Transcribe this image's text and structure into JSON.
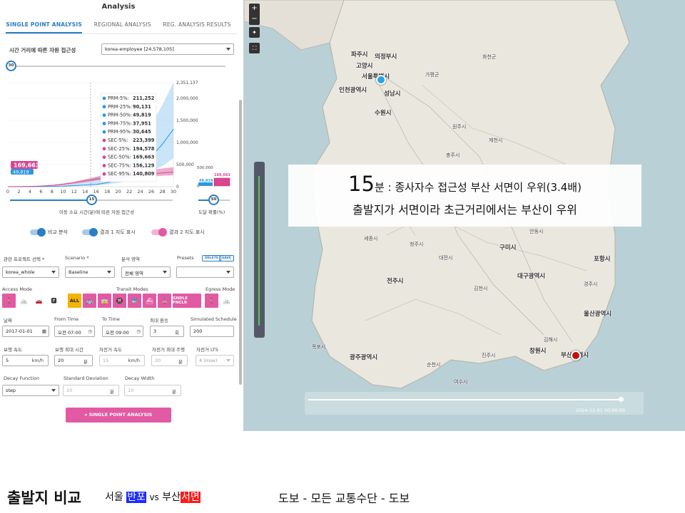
{
  "panel": {
    "title": "Analysis",
    "tabs": [
      "SINGLE POINT ANALYSIS",
      "REGIONAL ANALYSIS",
      "REG. ANALYSIS RESULTS"
    ],
    "chart_label": "시간 거리에 따른 자원 접근성",
    "dataset": "korea-employee [24,578,105]",
    "time_slider_value": "30",
    "time_slider_fraction": 0.0
  },
  "chart_data": {
    "type": "area",
    "xlabel": "이동 소요 시간(분)에 따른 자원 접근성",
    "x_ticks": [
      "0",
      "2",
      "4",
      "6",
      "8",
      "10",
      "12",
      "14",
      "16",
      "18",
      "20",
      "22",
      "24",
      "26",
      "28",
      "30"
    ],
    "y_ticks": [
      "2,351,137",
      "2,000,000",
      "1,500,000",
      "1,000,000",
      "500,000",
      "0"
    ],
    "ylim": [
      0,
      2351137
    ],
    "xlim": [
      0,
      30
    ],
    "value_label_main": "169,663",
    "value_label_secondary": "49,819",
    "cursor_x": 15,
    "cursor_label": "15",
    "tooltip": [
      {
        "label": "PRM-5%:",
        "value": "211,252",
        "color": "#2b97e0"
      },
      {
        "label": "PRM-25%:",
        "value": "90,131",
        "color": "#2b97e0"
      },
      {
        "label": "PRM-50%:",
        "value": "49,819",
        "color": "#2b97e0"
      },
      {
        "label": "PRM-75%:",
        "value": "37,951",
        "color": "#2b97e0"
      },
      {
        "label": "PRM-95%:",
        "value": "30,645",
        "color": "#2b97e0"
      },
      {
        "label": "SEC-5%:",
        "value": "223,399",
        "color": "#d9468f"
      },
      {
        "label": "SEC-25%:",
        "value": "194,578",
        "color": "#d9468f"
      },
      {
        "label": "SEC-50%:",
        "value": "169,663",
        "color": "#d9468f"
      },
      {
        "label": "SEC-75%:",
        "value": "156,129",
        "color": "#d9468f"
      },
      {
        "label": "SEC-95%:",
        "value": "140,809",
        "color": "#d9468f"
      }
    ],
    "series": [
      {
        "name": "PRM",
        "color": "#2b97e0",
        "x": [
          0,
          2,
          4,
          6,
          8,
          10,
          12,
          14,
          16,
          18,
          20,
          22,
          24,
          26,
          28,
          30
        ],
        "p5": [
          0,
          2000,
          5000,
          9000,
          16000,
          30000,
          60000,
          120000,
          211252,
          340000,
          520000,
          760000,
          1050000,
          1400000,
          1850000,
          2351137
        ],
        "p50": [
          0,
          800,
          2000,
          4000,
          7000,
          12000,
          24000,
          38000,
          49819,
          90000,
          160000,
          280000,
          450000,
          680000,
          960000,
          1300000
        ],
        "p95": [
          0,
          300,
          900,
          1800,
          3200,
          6000,
          12000,
          22000,
          30645,
          50000,
          85000,
          140000,
          220000,
          330000,
          470000,
          640000
        ]
      },
      {
        "name": "SEC",
        "color": "#d9468f",
        "x": [
          0,
          2,
          4,
          6,
          8,
          10,
          12,
          14,
          16,
          18,
          20,
          22,
          24,
          26,
          28,
          30
        ],
        "p5": [
          0,
          3000,
          9000,
          20000,
          40000,
          70000,
          110000,
          170000,
          223399,
          260000,
          290000,
          320000,
          350000,
          380000,
          410000,
          440000
        ],
        "p50": [
          0,
          2000,
          6000,
          15000,
          30000,
          55000,
          90000,
          135000,
          169663,
          200000,
          225000,
          250000,
          270000,
          290000,
          310000,
          330000
        ],
        "p95": [
          0,
          1000,
          3000,
          8000,
          18000,
          35000,
          60000,
          100000,
          140809,
          165000,
          185000,
          200000,
          215000,
          230000,
          245000,
          260000
        ]
      }
    ],
    "side_chart": {
      "label": "도달 확률(%)",
      "y_ticks": [
        "500,000",
        "0"
      ],
      "bar_blue_label": "49,819",
      "bar_pink_label": "169,663",
      "slider_value": "50",
      "slider_fraction": 0.5
    }
  },
  "chart_slider": {
    "value": "15",
    "fraction": 0.5
  },
  "toggles": [
    {
      "label": "비교 분석",
      "color": "#2b7dc4"
    },
    {
      "label": "결과 1 지도 표시",
      "color": "#2b7dc4"
    },
    {
      "label": "결과 2 지도 표시",
      "color": "#e25aa3"
    }
  ],
  "form": {
    "project_label": "관련 프로젝트 선택 *",
    "project_value": "korea_whole",
    "scenario_label": "Scenario *",
    "scenario_value": "Baseline",
    "area_label": "분석 영역",
    "area_value": "전체 영역",
    "presets_label": "Presets",
    "delete_label": "DELETE",
    "save_label": "SAVE",
    "presets_value": "",
    "access_mode_label": "Access Mode",
    "transit_modes_label": "Transit Modes",
    "egress_mode_label": "Egress Mode",
    "all_label": "ALL",
    "cable_label": "GNDLE FNCLR",
    "date_label": "날짜",
    "date_value": "2017-01-01",
    "from_label": "From Time",
    "from_value": "오전 07:00",
    "to_label": "To Time",
    "to_value": "오전 09:00",
    "max_transfer_label": "최대 환승",
    "max_transfer_value": "3",
    "max_transfer_unit": "회",
    "sim_label": "Simulated Schedule",
    "sim_value": "200",
    "walk_speed_label": "보행 속도",
    "walk_speed_value": "5",
    "walk_speed_unit": "km/h",
    "walk_max_label": "보행 최대 시간",
    "walk_max_value": "20",
    "walk_max_unit": "분",
    "bike_speed_label": "자전거 속도",
    "bike_speed_value": "15",
    "bike_speed_unit": "km/h",
    "bike_max_label": "자전거 최대 주행",
    "bike_max_value": "20",
    "bike_max_unit": "분",
    "bike_lts_label": "자전거 LTS",
    "bike_lts_value": "4 (max)",
    "decay_label": "Decay Function",
    "decay_value": "step",
    "stddev_label": "Standard Deviation",
    "stddev_value": "10",
    "stddev_unit": "분",
    "width_label": "Decay Width",
    "width_value": "10",
    "width_unit": "분",
    "run_label": "SINGLE POINT ANALYSIS"
  },
  "map": {
    "callout_big": "15",
    "callout_line1_rest": "분 : 종사자수 접근성 부산 서면이 우위(3.4배)",
    "callout_line2": "출발지가 서면이라 초근거리에서는 부산이 우위",
    "timestamp": "2024-12-01 00:00:00",
    "cities": [
      {
        "name": "파주시"
      },
      {
        "name": "의정부시"
      },
      {
        "name": "고양시"
      },
      {
        "name": "서울특별시"
      },
      {
        "name": "인천광역시"
      },
      {
        "name": "성남시"
      },
      {
        "name": "수원시"
      },
      {
        "name": "구미시"
      },
      {
        "name": "포항시"
      },
      {
        "name": "대구광역시"
      },
      {
        "name": "전주시"
      },
      {
        "name": "울산광역시"
      },
      {
        "name": "창원시"
      },
      {
        "name": "부산광역시"
      },
      {
        "name": "광주광역시"
      }
    ],
    "small_towns": [
      {
        "name": "가평군"
      },
      {
        "name": "화천군"
      },
      {
        "name": "원주시"
      },
      {
        "name": "제천시"
      },
      {
        "name": "충주시"
      },
      {
        "name": "청주시"
      },
      {
        "name": "세종시"
      },
      {
        "name": "대전시"
      },
      {
        "name": "안동시"
      },
      {
        "name": "김천시"
      },
      {
        "name": "경주시"
      },
      {
        "name": "순천시"
      },
      {
        "name": "목포시"
      },
      {
        "name": "여수시"
      },
      {
        "name": "진주시"
      },
      {
        "name": "김해시"
      }
    ],
    "origin_blue_color": "#22a6e8",
    "origin_red_color": "#c41010"
  },
  "caption": {
    "title": "출발지 비교",
    "seoul": "서울",
    "seoul_hl": "반포",
    "vs": "vs",
    "busan": "부산",
    "busan_hl": "서면",
    "mode": "도보 - 모든 교통수단 - 도보"
  }
}
